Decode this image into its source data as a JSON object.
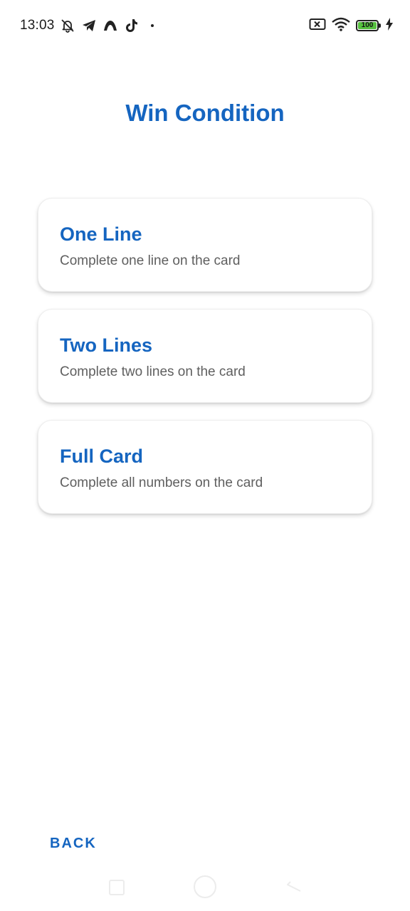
{
  "status_bar": {
    "time": "13:03",
    "battery_level": "100",
    "battery_percent": 1.0,
    "icons_left": [
      "mute-icon",
      "telegram-icon",
      "app-icon",
      "tiktok-icon"
    ],
    "icons_right": [
      "sim-icon",
      "wifi-icon",
      "battery-icon",
      "charging-icon"
    ]
  },
  "page": {
    "title": "Win Condition"
  },
  "options": [
    {
      "title": "One Line",
      "description": "Complete one line on the card"
    },
    {
      "title": "Two Lines",
      "description": "Complete two lines on the card"
    },
    {
      "title": "Full Card",
      "description": "Complete all numbers on the card"
    }
  ],
  "actions": {
    "back_label": "BACK"
  },
  "colors": {
    "accent": "#1565c0",
    "description_text": "#5f5f5f",
    "background": "#ffffff",
    "battery_fill": "#56c13f"
  }
}
